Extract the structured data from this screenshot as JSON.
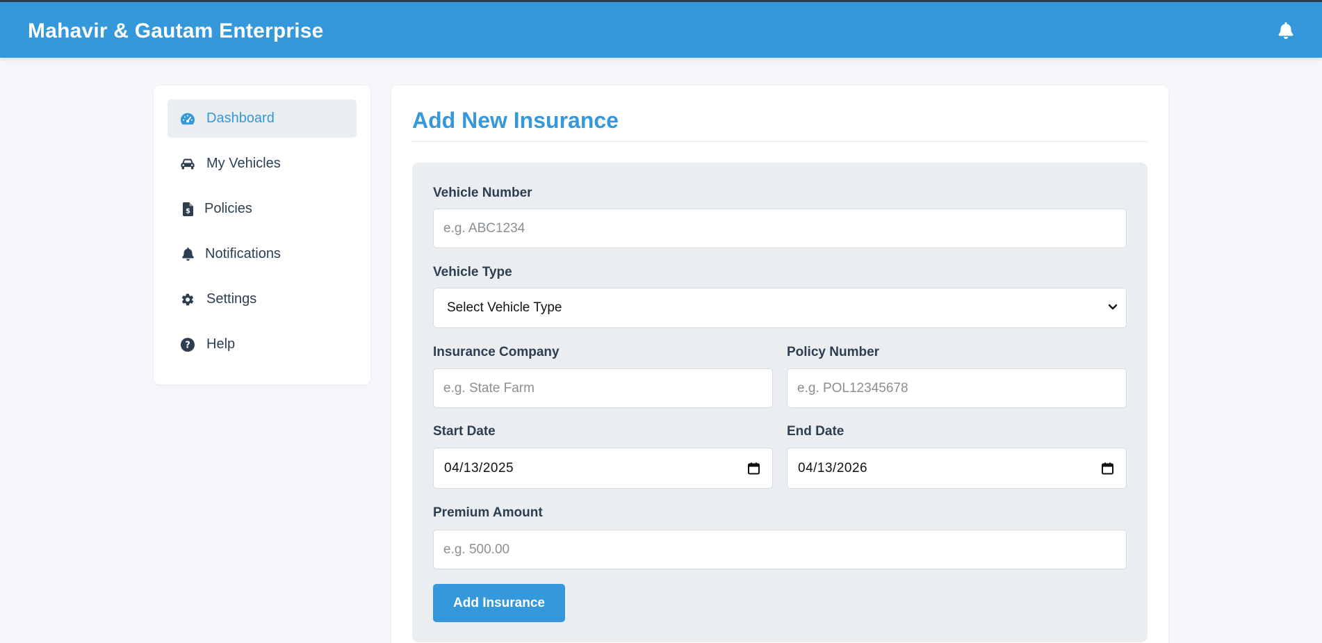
{
  "app": {
    "brand": "Mahavir & Gautam Enterprise",
    "accent_color": "#3498db",
    "header_icon": "bell-icon"
  },
  "sidebar": {
    "items": [
      {
        "label": "Dashboard",
        "icon": "gauge-icon",
        "active": true
      },
      {
        "label": "My Vehicles",
        "icon": "car-icon",
        "active": false
      },
      {
        "label": "Policies",
        "icon": "file-invoice-icon",
        "active": false
      },
      {
        "label": "Notifications",
        "icon": "bell-icon",
        "active": false
      },
      {
        "label": "Settings",
        "icon": "gear-icon",
        "active": false
      },
      {
        "label": "Help",
        "icon": "question-circle-icon",
        "active": false
      }
    ]
  },
  "main": {
    "title": "Add New Insurance",
    "form": {
      "vehicle_number": {
        "label": "Vehicle Number",
        "placeholder": "e.g. ABC1234",
        "value": ""
      },
      "vehicle_type": {
        "label": "Vehicle Type",
        "selected": "Select Vehicle Type"
      },
      "insurance_company": {
        "label": "Insurance Company",
        "placeholder": "e.g. State Farm",
        "value": ""
      },
      "policy_number": {
        "label": "Policy Number",
        "placeholder": "e.g. POL12345678",
        "value": ""
      },
      "start_date": {
        "label": "Start Date",
        "value": "04/13/2025"
      },
      "end_date": {
        "label": "End Date",
        "value": "04/13/2026"
      },
      "premium_amount": {
        "label": "Premium Amount",
        "placeholder": "e.g. 500.00",
        "value": ""
      },
      "submit_label": "Add Insurance"
    }
  }
}
